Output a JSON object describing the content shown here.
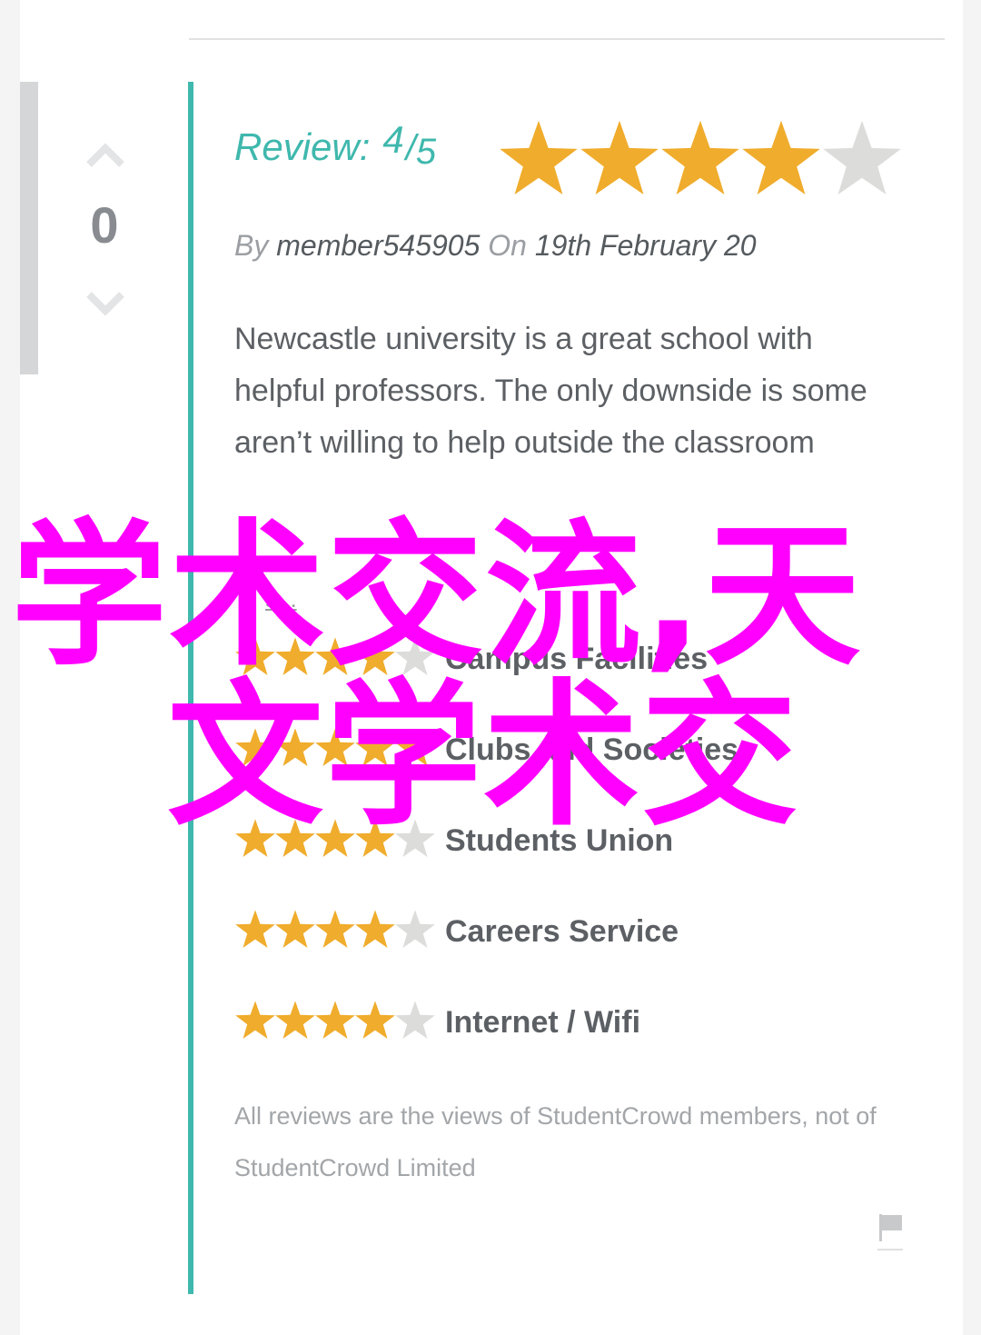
{
  "vote": {
    "count": "0",
    "up_icon": "chevron-up-icon",
    "down_icon": "chevron-down-icon"
  },
  "review": {
    "label": "Review:",
    "score": "4",
    "slash": "/",
    "max": "5",
    "rating_value": 4,
    "rating_max": 5,
    "by_label": "By",
    "author": "member545905",
    "on_label": "On",
    "date": "19th February 20",
    "body": "Newcastle university is a great school with helpful professors. The only downside is some aren’t willing to help outside the classroom",
    "read_more": "s..."
  },
  "categories": [
    {
      "label": "Campus Facilities",
      "rating": 4
    },
    {
      "label": "Clubs and Societies",
      "rating": 5
    },
    {
      "label": "Students Union",
      "rating": 4
    },
    {
      "label": "Careers Service",
      "rating": 4
    },
    {
      "label": "Internet / Wifi",
      "rating": 4
    }
  ],
  "disclaimer": "All reviews are the views of StudentCrowd members, not of StudentCrowd Limited",
  "flag_icon": "flag-icon",
  "watermark": {
    "line1": "学术交流,天",
    "line2": "文学术交"
  },
  "colors": {
    "accent": "#3fb8ad",
    "star_filled": "#f0ac2c",
    "star_empty": "#dcdcda",
    "watermark": "#ff00ff"
  }
}
